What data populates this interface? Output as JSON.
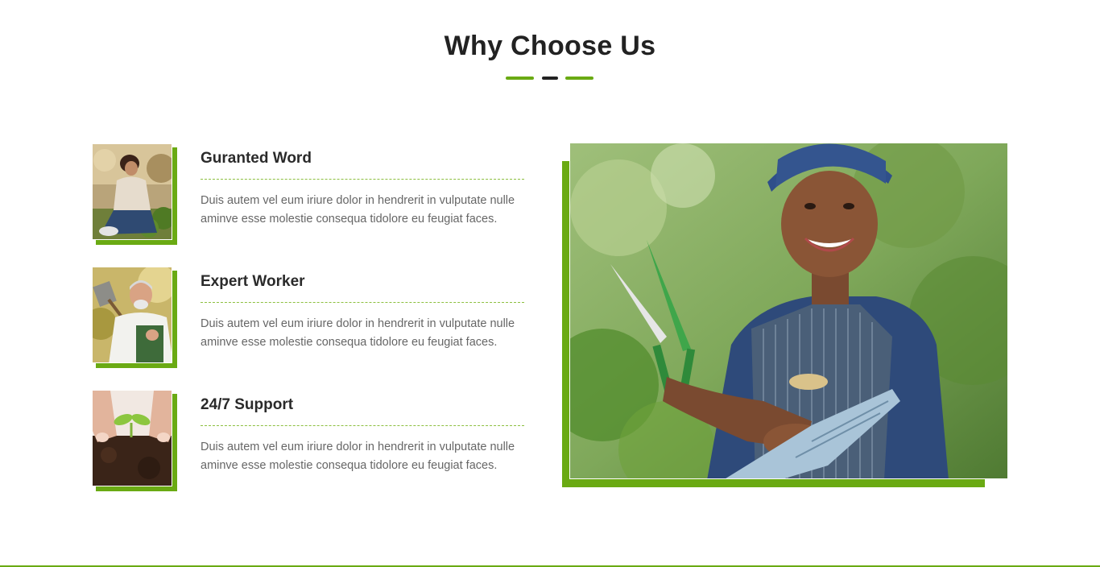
{
  "section": {
    "title": "Why Choose Us"
  },
  "colors": {
    "accent": "#6aaa13",
    "heading": "#222222",
    "body_text": "#666666"
  },
  "features": [
    {
      "title": "Guranted Word",
      "text": "Duis autem vel eum iriure dolor in hendrerit in vulputate nulle aminve esse molestie consequa tidolore eu feugiat faces.",
      "image": "woman-gardening-photo"
    },
    {
      "title": "Expert Worker",
      "text": "Duis autem vel eum iriure dolor in hendrerit in vulputate nulle aminve esse molestie consequa tidolore eu feugiat faces.",
      "image": "older-gardener-with-shovel-photo"
    },
    {
      "title": "24/7 Support",
      "text": "Duis autem vel eum iriure dolor in hendrerit in vulputate nulle aminve esse molestie consequa tidolore eu feugiat faces.",
      "image": "hands-planting-seedling-photo"
    }
  ],
  "hero_image": "smiling-gardener-with-shears-photo"
}
